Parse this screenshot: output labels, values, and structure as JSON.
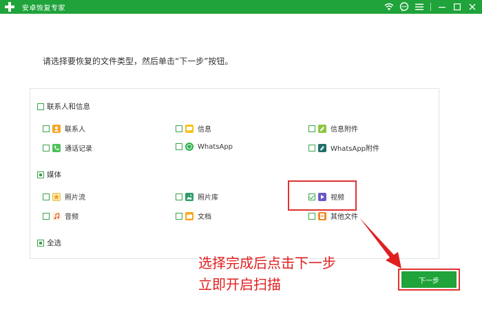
{
  "titlebar": {
    "title": "安卓恢复专家",
    "icons": [
      "wifi-icon",
      "chat-icon",
      "menu-icon",
      "minimize-icon",
      "restore-icon",
      "close-icon"
    ],
    "color": "#1fa33a"
  },
  "instruction": "请选择要恢复的文件类型，然后单击“下一步”按钮。",
  "groups": {
    "contacts": {
      "title": "联系人和信息",
      "checked": false,
      "items": [
        {
          "label": "联系人",
          "icon": "contact-icon",
          "checked": false
        },
        {
          "label": "信息",
          "icon": "message-icon",
          "checked": false
        },
        {
          "label": "信息附件",
          "icon": "attachment-icon",
          "checked": false
        },
        {
          "label": "通话记录",
          "icon": "phone-icon",
          "checked": false
        },
        {
          "label": "WhatsApp",
          "icon": "whatsapp-icon",
          "checked": false
        },
        {
          "label": "WhatsApp附件",
          "icon": "whatsapp-attachment-icon",
          "checked": false
        }
      ]
    },
    "media": {
      "title": "媒体",
      "checked": "partial",
      "items": [
        {
          "label": "照片流",
          "icon": "photostream-icon",
          "checked": false
        },
        {
          "label": "照片库",
          "icon": "photo-library-icon",
          "checked": false
        },
        {
          "label": "视频",
          "icon": "video-icon",
          "checked": true
        },
        {
          "label": "音频",
          "icon": "audio-icon",
          "checked": false
        },
        {
          "label": "文档",
          "icon": "document-icon",
          "checked": false
        },
        {
          "label": "其他文件",
          "icon": "other-files-icon",
          "checked": false
        }
      ]
    },
    "select_all": {
      "label": "全选",
      "checked": "partial"
    }
  },
  "annotation": {
    "line1": "选择完成后点击下一步",
    "line2": "立即开启扫描",
    "color": "#e02020"
  },
  "next_button": {
    "label": "下一步"
  }
}
